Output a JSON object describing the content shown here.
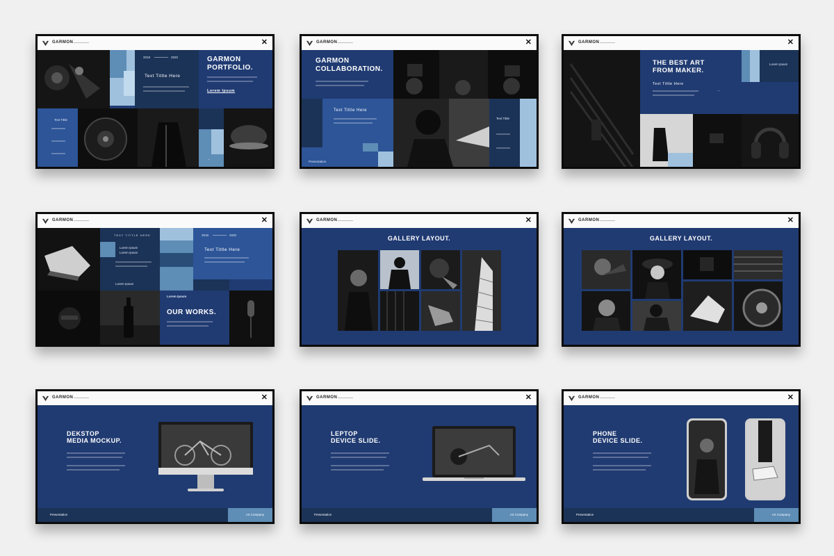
{
  "brand": "GARMON",
  "close_glyph": "✕",
  "icons": {
    "logo": "garmon-v-logo-icon",
    "close": "close-icon"
  },
  "colors": {
    "navy": "#203b72",
    "steel": "#5e8db6",
    "light": "#9fc1de",
    "page": "#f0f0f0"
  },
  "slides": {
    "s1": {
      "title_1": "GARMON",
      "title_2": "PORTFOLIO.",
      "year_start": "2018",
      "year_end": "2020",
      "subtitle": "Text Tittle Here",
      "link": "Lorem Ipsum",
      "side_label": "Text Tittle"
    },
    "s2": {
      "title_1": "GARMON",
      "title_2": "COLLABORATION.",
      "subtitle": "Text Tittle Here",
      "side_label": "Text Tittle",
      "footer": "Presentation"
    },
    "s3": {
      "title_1": "THE BEST ART",
      "title_2": "FROM MAKER.",
      "subtitle": "Text Tittle Here",
      "info": "Lorem Ipsum"
    },
    "s4": {
      "header": "TEXT TITTLE HERE",
      "year_start": "2018",
      "year_end": "2020",
      "subtitle": "Text Tittle Here",
      "small_1": "Lorem Ipsum",
      "small_2": "Lorem Ipsum",
      "link": "Lorem Ipsum",
      "title": "OUR WORKS."
    },
    "s5": {
      "title": "GALLERY LAYOUT."
    },
    "s6": {
      "title": "GALLERY LAYOUT."
    },
    "s7": {
      "title_1": "DEKSTOP",
      "title_2": "MEDIA MOCKUP.",
      "footer_left": "Presentation",
      "footer_right": "Art Company"
    },
    "s8": {
      "title_1": "LEPTOP",
      "title_2": "DEVICE SLIDE.",
      "footer_left": "Presentation",
      "footer_right": "Art Company"
    },
    "s9": {
      "title_1": "PHONE",
      "title_2": "DEVICE SLIDE.",
      "footer_left": "Presentation",
      "footer_right": "Art Company"
    }
  }
}
